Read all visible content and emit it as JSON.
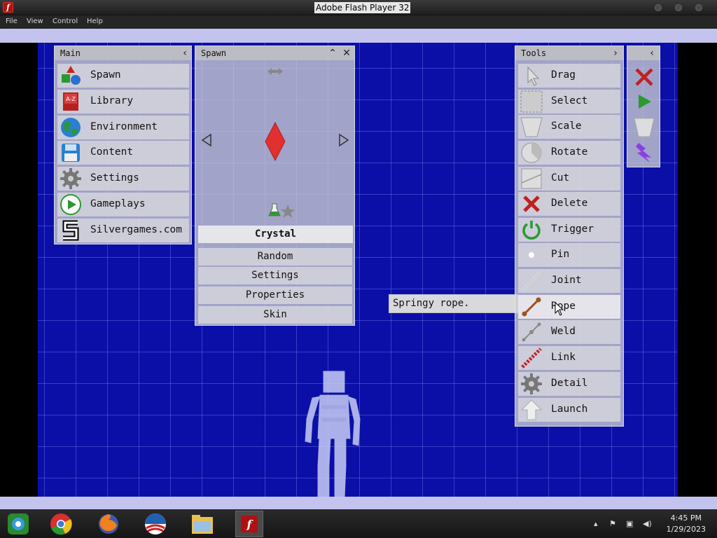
{
  "window": {
    "title": "Adobe Flash Player 32"
  },
  "menu": [
    "File",
    "View",
    "Control",
    "Help"
  ],
  "main_panel": {
    "title": "Main",
    "items": [
      {
        "label": "Spawn",
        "icon": "spawn-shapes-icon"
      },
      {
        "label": "Library",
        "icon": "library-book-icon"
      },
      {
        "label": "Environment",
        "icon": "globe-icon"
      },
      {
        "label": "Content",
        "icon": "floppy-disk-icon"
      },
      {
        "label": "Settings",
        "icon": "gear-icon"
      },
      {
        "label": "Gameplays",
        "icon": "play-icon"
      },
      {
        "label": "Silvergames.com",
        "icon": "silvergames-logo-icon"
      }
    ]
  },
  "spawn_panel": {
    "title": "Spawn",
    "selected": "Crystal",
    "options": [
      "Random",
      "Settings",
      "Properties",
      "Skin"
    ]
  },
  "tools_panel": {
    "title": "Tools",
    "items": [
      {
        "label": "Drag",
        "icon": "cursor-arrow-icon"
      },
      {
        "label": "Select",
        "icon": "select-box-icon"
      },
      {
        "label": "Scale",
        "icon": "scale-trapezoid-icon"
      },
      {
        "label": "Rotate",
        "icon": "rotate-pie-icon"
      },
      {
        "label": "Cut",
        "icon": "cut-line-icon"
      },
      {
        "label": "Delete",
        "icon": "delete-x-icon"
      },
      {
        "label": "Trigger",
        "icon": "trigger-power-icon"
      },
      {
        "label": "Pin",
        "icon": "pin-dot-icon"
      },
      {
        "label": "Joint",
        "icon": "joint-line-icon"
      },
      {
        "label": "Rope",
        "icon": "rope-icon"
      },
      {
        "label": "Weld",
        "icon": "weld-icon"
      },
      {
        "label": "Link",
        "icon": "link-chain-icon"
      },
      {
        "label": "Detail",
        "icon": "detail-gear-icon"
      },
      {
        "label": "Launch",
        "icon": "launch-arrow-icon"
      }
    ]
  },
  "tooltip": "Springy rope.",
  "taskbar": {
    "apps": [
      "ie-icon",
      "chrome-icon",
      "firefox-icon",
      "obama-logo-icon",
      "file-explorer-icon",
      "flash-player-icon"
    ],
    "time": "4:45 PM",
    "date": "1/29/2023"
  },
  "colors": {
    "background": "#0b0fa8",
    "crystal": "#e03030",
    "accent_green": "#22aa33"
  }
}
